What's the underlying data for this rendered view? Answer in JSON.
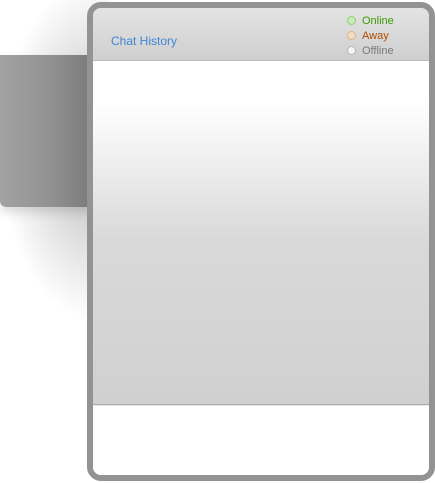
{
  "header": {
    "title": "Chat History"
  },
  "legend": [
    {
      "label": "Online",
      "color": "#3a9a00",
      "dot_fill": "#c9ecb9",
      "dot_border": "#8fcf73"
    },
    {
      "label": "Away",
      "color": "#b04a00",
      "dot_fill": "#f3dec3",
      "dot_border": "#d9b58a"
    },
    {
      "label": "Offline",
      "color": "#7a7a7a",
      "dot_fill": "#f6f6f6",
      "dot_border": "#b5b5b5"
    }
  ],
  "colors": {
    "title": "#3d86d6",
    "frame": "#939393"
  }
}
